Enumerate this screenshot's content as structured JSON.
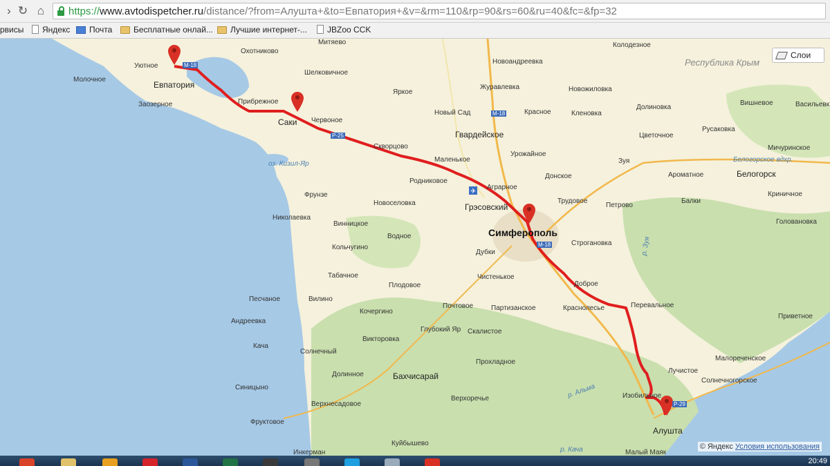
{
  "browser": {
    "url_scheme": "https://",
    "url_host": "www.avtodispetcher.ru",
    "url_path": "/distance/?from=Алушта+&to=Евпатория+&v=&rm=110&rp=90&rs=60&ru=40&fc=&fp=32"
  },
  "bookmarks": [
    {
      "label": "рвисы",
      "icon": "grid-icon"
    },
    {
      "label": "Яндекс",
      "icon": "page-icon"
    },
    {
      "label": "Почта",
      "icon": "mail-icon"
    },
    {
      "label": "Бесплатные онлай...",
      "icon": "folder-icon"
    },
    {
      "label": "Лучшие интернет-...",
      "icon": "folder-icon"
    },
    {
      "label": "JBZoo CCK",
      "icon": "page-icon"
    }
  ],
  "map": {
    "layers_label": "Слои",
    "copyright": "© Яндекс",
    "terms_link": "Условия использования",
    "colors": {
      "sea": "#a6c9e6",
      "land": "#f5f1dc",
      "forest": "#c9dfae",
      "route": "#e01e1e",
      "marker": "#d93025",
      "road": "#f2b84b"
    },
    "markers": [
      "Евпатория",
      "Саки",
      "Симферополь",
      "Алушта"
    ],
    "labels": {
      "evpatoria": "Евпатория",
      "saki": "Саки",
      "simferopol": "Симферополь",
      "alushta": "Алушта",
      "bakhchisaray": "Бахчисарай",
      "gvardeyskoe": "Гвардейское",
      "gresovsky": "Грэсовский",
      "belogorsk": "Белогорск",
      "republic": "Республика Крым",
      "utnoe": "Уютное",
      "molochnoe": "Молочное",
      "zaozernoe": "Заозерное",
      "okhotnikovo": "Охотниково",
      "mityaevo": "Митяево",
      "shelkovichnoe": "Шелковичное",
      "yarkoe": "Яркое",
      "pribrezhnoe": "Прибрежное",
      "chervonoe": "Червоное",
      "novy_sad": "Новый Сад",
      "novoandreevka": "Новоандреевка",
      "zhuravlevka": "Журавлевка",
      "krasnoe": "Красное",
      "novozhilovka": "Новожиловка",
      "kolodeznoe": "Колодезное",
      "klenovka": "Кленовка",
      "dolinovka": "Долиновка",
      "vishnevoe": "Вишневое",
      "vasilevka": "Васильевка",
      "rusakovka": "Русаковка",
      "tsvetochnoe": "Цветочное",
      "michurinskoe": "Мичуринское",
      "skvortsovo": "Скворцово",
      "urozhaynoe": "Урожайное",
      "zuya": "Зуя",
      "belogorskoe_vdhr": "Белогорское вдхр.",
      "kizil_yar": "оз. Кизил-Яр",
      "malenkoe": "Маленькое",
      "rodnikovoe": "Родниковое",
      "agrarnoe": "Аграрное",
      "donskoe": "Донское",
      "aromatnoe": "Ароматное",
      "krinichnoe": "Криничное",
      "frunze": "Фрунзе",
      "novoselovka": "Новоселовка",
      "trudovoe": "Трудовое",
      "petrovo": "Петрово",
      "balki": "Балки",
      "golovanovka": "Голованов­ка",
      "nikolaevka": "Николаевка",
      "vinnitskoe": "Винницкое",
      "vodnoe": "Водное",
      "kolchugino": "Кольчугино",
      "dubki": "Дубки",
      "stroganovka": "Строгановка",
      "tabachnoe": "Табачное",
      "plodovoe": "Плодовое",
      "chistenkoe": "Чистенькое",
      "dobroe": "Доброе",
      "peschanoe": "Песчаное",
      "vilino": "Вилино",
      "pochtovoe": "Почтовое",
      "partizanskoe": "Партизанское",
      "krasnolesye": "Краснолесье",
      "perevalnoe": "Перевальное",
      "privetnoe": "Приветное",
      "andreevka": "Андреевка",
      "kocherygino": "Кочергино",
      "glubokiy_yar": "Глубокий Яр",
      "skalistoe": "Скалистое",
      "kacha": "Кача",
      "viktorovka": "Викторовка",
      "solnechny": "Солнечный",
      "prokhladnoe": "Прохладное",
      "luchistoe": "Лучистое",
      "malorechenskoe": "Малореченское",
      "dolinnoe": "Долинное",
      "solnechnogorskoe": "Солнечногорское",
      "sinitsyno": "Синицыно",
      "verkhoreche": "Верхоречье",
      "izobilnoe": "Изобильное",
      "verkhnesadovoe": "Верхнесадовое",
      "fruktovoe": "Фруктовое",
      "kuybyshevo": "Куйбышево",
      "inkerman": "Инкерман",
      "maly_mayak": "Малый Маяк",
      "r_zuya": "р. Зуя",
      "r_alma": "р. Альма",
      "r_kacha": "р. Кача",
      "m18_a": "М-18",
      "m18_b": "М-18",
      "m18_c": "М-18",
      "m29": "Р-29",
      "r25": "Р-25"
    }
  },
  "taskbar": {
    "clock": "20:49"
  }
}
